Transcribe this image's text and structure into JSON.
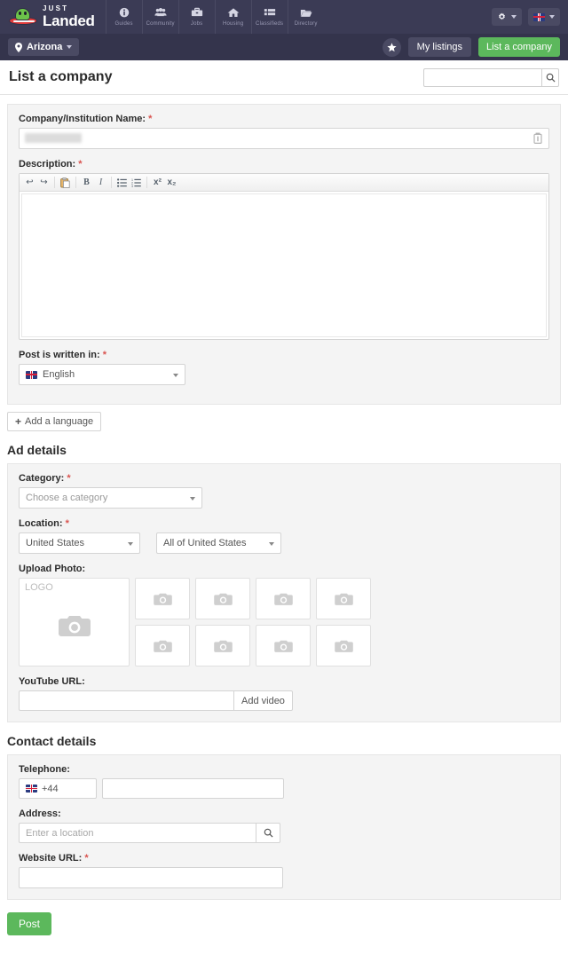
{
  "topnav": {
    "brand": {
      "line1": "JUST",
      "line2": "Landed",
      "icon": "ufo-logo-icon"
    },
    "items": [
      {
        "label": "Guides",
        "icon": "info-circle-icon"
      },
      {
        "label": "Community",
        "icon": "people-group-icon"
      },
      {
        "label": "Jobs",
        "icon": "briefcase-icon"
      },
      {
        "label": "Housing",
        "icon": "house-icon"
      },
      {
        "label": "Classifieds",
        "icon": "list-grid-icon"
      },
      {
        "label": "Directory",
        "icon": "folder-open-icon"
      }
    ],
    "settings_icon": "gear-icon",
    "language_flag": "uk-flag-icon"
  },
  "subbar": {
    "location": "Arizona",
    "location_icon": "map-pin-icon",
    "favorites_icon": "star-icon",
    "my_listings": "My listings",
    "list_a_company": "List a company"
  },
  "page": {
    "title": "List a company",
    "search_value": "",
    "search_icon": "search-icon"
  },
  "company_section": {
    "name_label": "Company/Institution Name:",
    "name_required": "*",
    "name_value": "",
    "clear_icon": "trash-icon",
    "description_label": "Description:",
    "description_required": "*",
    "description_value": "",
    "editor_tools": [
      {
        "name": "undo-icon",
        "glyph": "↩"
      },
      {
        "name": "redo-icon",
        "glyph": "↪"
      },
      {
        "name": "paste-icon",
        "glyph": ""
      },
      {
        "name": "bold-icon",
        "glyph": "B"
      },
      {
        "name": "italic-icon",
        "glyph": "I"
      },
      {
        "name": "bullet-list-icon",
        "glyph": ""
      },
      {
        "name": "numbered-list-icon",
        "glyph": ""
      },
      {
        "name": "superscript-icon",
        "glyph": "x²"
      },
      {
        "name": "subscript-icon",
        "glyph": "x₂"
      }
    ],
    "language_label": "Post is written in:",
    "language_required": "*",
    "language_value": "English",
    "add_language": "Add a language"
  },
  "ad_details": {
    "heading": "Ad details",
    "category_label": "Category:",
    "category_required": "*",
    "category_value": "Choose a category",
    "location_label": "Location:",
    "location_required": "*",
    "country_value": "United States",
    "region_value": "All of United States",
    "upload_label": "Upload Photo:",
    "logo_placeholder": "LOGO",
    "camera_icon": "camera-icon",
    "photo_slots": 8,
    "youtube_label": "YouTube URL:",
    "youtube_value": "",
    "add_video": "Add video"
  },
  "contact_details": {
    "heading": "Contact details",
    "telephone_label": "Telephone:",
    "dial_code": "+44",
    "dial_flag": "uk-flag-icon",
    "telephone_value": "",
    "address_label": "Address:",
    "address_placeholder": "Enter a location",
    "address_value": "",
    "address_search_icon": "search-icon",
    "website_label": "Website URL:",
    "website_required": "*",
    "website_value": ""
  },
  "footer": {
    "post_label": "Post"
  },
  "colors": {
    "nav_bg": "#3b3b55",
    "subbar_bg": "#34344c",
    "green": "#5cb85c",
    "required_red": "#d9534f",
    "panel_bg": "#f4f4f4"
  }
}
